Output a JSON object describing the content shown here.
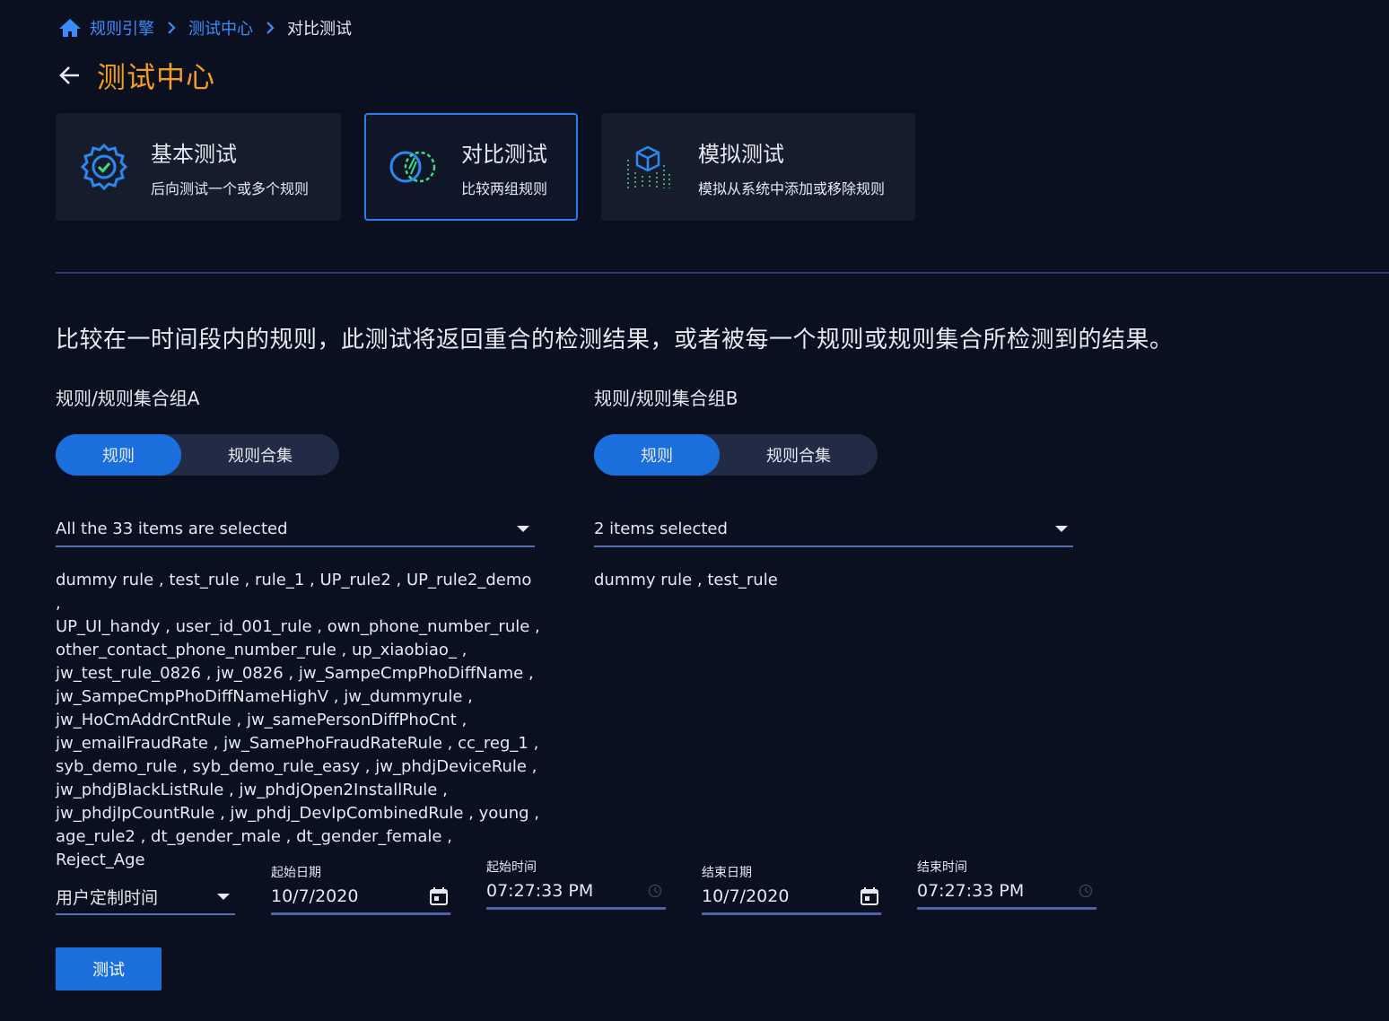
{
  "breadcrumb": {
    "items": [
      "规则引擎",
      "测试中心"
    ],
    "current": "对比测试"
  },
  "page": {
    "title": "测试中心"
  },
  "cards": [
    {
      "title": "基本测试",
      "desc": "后向测试一个或多个规则",
      "icon": "gear-check-icon"
    },
    {
      "title": "对比测试",
      "desc": "比较两组规则",
      "icon": "overlap-circles-icon"
    },
    {
      "title": "模拟测试",
      "desc": "模拟从系统中添加或移除规则",
      "icon": "cube-data-icon"
    }
  ],
  "description": "比较在一时间段内的规则，此测试将返回重合的检测结果，或者被每一个规则或规则集合所检测到的结果。",
  "group_a": {
    "label": "规则/规则集合组A",
    "toggle": {
      "selected": "规则",
      "other": "规则合集"
    },
    "select_value": "All the 33 items are selected",
    "rules_lines": [
      "dummy rule , test_rule , rule_1 , UP_rule2 , UP_rule2_demo ,",
      "UP_UI_handy , user_id_001_rule , own_phone_number_rule ,",
      "other_contact_phone_number_rule , up_xiaobiao_ ,",
      "jw_test_rule_0826 , jw_0826 , jw_SampeCmpPhoDiffName ,",
      "jw_SampeCmpPhoDiffNameHighV , jw_dummyrule ,",
      "jw_HoCmAddrCntRule , jw_samePersonDiffPhoCnt ,",
      "jw_emailFraudRate , jw_SamePhoFraudRateRule , cc_reg_1 ,",
      "syb_demo_rule , syb_demo_rule_easy , jw_phdjDeviceRule ,",
      "jw_phdjBlackListRule , jw_phdjOpen2InstallRule ,",
      "jw_phdjIpCountRule , jw_phdj_DevIpCombinedRule , young ,",
      "age_rule2 , dt_gender_male , dt_gender_female , Reject_Age"
    ]
  },
  "group_b": {
    "label": "规则/规则集合组B",
    "toggle": {
      "selected": "规则",
      "other": "规则合集"
    },
    "select_value": "2 items selected",
    "rules_lines": [
      "dummy rule , test_rule"
    ]
  },
  "time": {
    "range_select": "用户定制时间",
    "start_date_label": "起始日期",
    "start_date": "10/7/2020",
    "start_time_label": "起始时间",
    "start_time": "07:27:33 PM",
    "end_date_label": "结束日期",
    "end_date": "10/7/2020",
    "end_time_label": "结束时间",
    "end_time": "07:27:33 PM"
  },
  "actions": {
    "test_label": "测试"
  },
  "colors": {
    "background": "#0b1020",
    "accent_blue": "#1b6fdc",
    "title_orange": "#f39c1f",
    "link_blue": "#3d8bff"
  }
}
